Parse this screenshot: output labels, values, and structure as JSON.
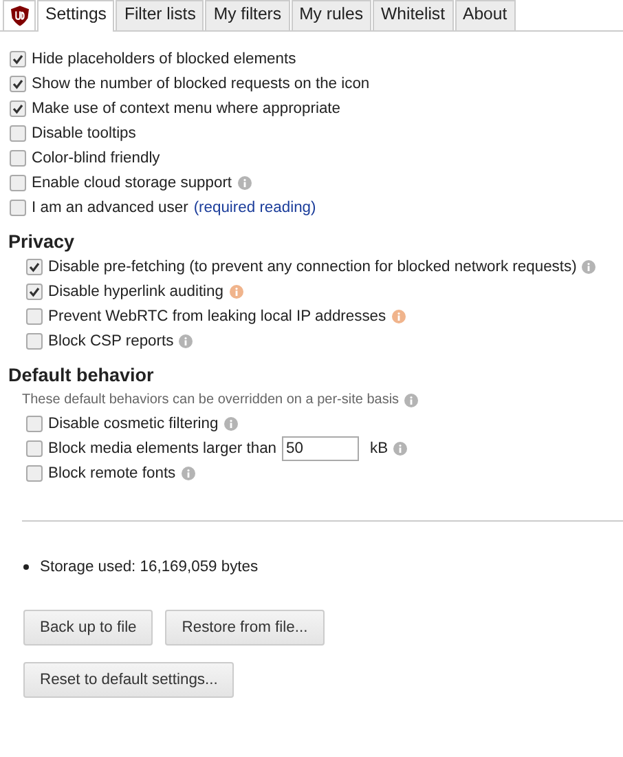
{
  "tabs": [
    {
      "label": "Settings",
      "selected": true
    },
    {
      "label": "Filter lists",
      "selected": false
    },
    {
      "label": "My filters",
      "selected": false
    },
    {
      "label": "My rules",
      "selected": false
    },
    {
      "label": "Whitelist",
      "selected": false
    },
    {
      "label": "About",
      "selected": false
    }
  ],
  "general": [
    {
      "label": "Hide placeholders of blocked elements",
      "checked": true
    },
    {
      "label": "Show the number of blocked requests on the icon",
      "checked": true
    },
    {
      "label": "Make use of context menu where appropriate",
      "checked": true
    },
    {
      "label": "Disable tooltips",
      "checked": false
    },
    {
      "label": "Color-blind friendly",
      "checked": false
    },
    {
      "label": "Enable cloud storage support",
      "checked": false,
      "info": {
        "color": "#b4b4b4"
      }
    },
    {
      "label": "I am an advanced user",
      "checked": false,
      "link": "(required reading)"
    }
  ],
  "privacy": {
    "title": "Privacy",
    "items": [
      {
        "label": "Disable pre-fetching (to prevent any connection for blocked network requests)",
        "checked": true,
        "info": {
          "color": "#b4b4b4"
        }
      },
      {
        "label": "Disable hyperlink auditing",
        "checked": true,
        "info": {
          "color": "#f0b48c"
        }
      },
      {
        "label": "Prevent WebRTC from leaking local IP addresses",
        "checked": false,
        "info": {
          "color": "#f0b48c"
        }
      },
      {
        "label": "Block CSP reports",
        "checked": false,
        "info": {
          "color": "#b4b4b4"
        }
      }
    ]
  },
  "default_behavior": {
    "title": "Default behavior",
    "note": "These default behaviors can be overridden on a per-site basis",
    "items": [
      {
        "label": "Disable cosmetic filtering",
        "checked": false,
        "info": {
          "color": "#b4b4b4"
        }
      },
      {
        "label": "Block media elements larger than",
        "checked": false,
        "value": "50",
        "unit": "kB",
        "info": {
          "color": "#b4b4b4"
        }
      },
      {
        "label": "Block remote fonts",
        "checked": false,
        "info": {
          "color": "#b4b4b4"
        }
      }
    ]
  },
  "storage_used": "Storage used: 16,169,059 bytes",
  "buttons": [
    [
      "Back up to file",
      "Restore from file..."
    ],
    [
      "Reset to default settings..."
    ]
  ]
}
